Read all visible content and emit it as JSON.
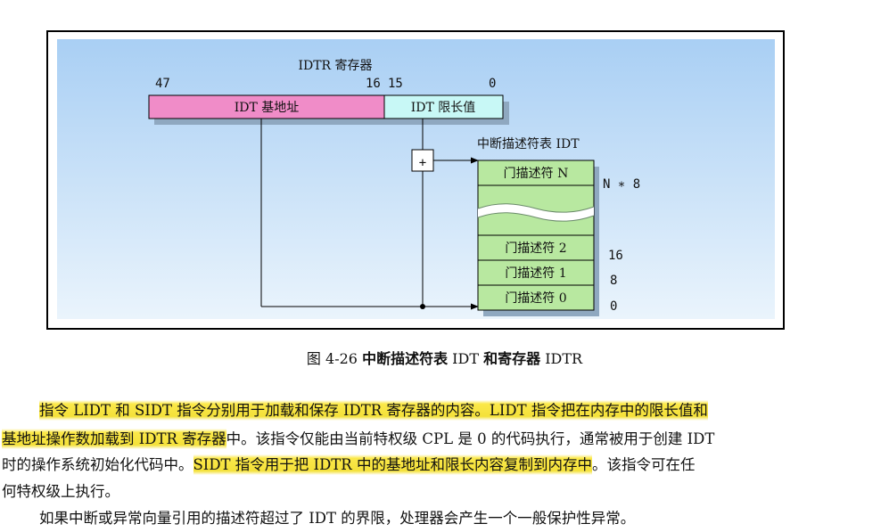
{
  "figure": {
    "register_title": "IDTR 寄存器",
    "bit_47": "47",
    "bit_16": "16",
    "bit_15": "15",
    "bit_0": "0",
    "base_label": "IDT 基地址",
    "limit_label": "IDT 限长值",
    "table_title": "中断描述符表 IDT",
    "gate_n": "门描述符 N",
    "gate_2": "门描述符 2",
    "gate_1": "门描述符 1",
    "gate_0": "门描述符 0",
    "offset_n8": "N ∗ 8",
    "offset_16": "16",
    "offset_8": "8",
    "offset_0": "0",
    "adder_symbol": "+",
    "colors": {
      "background_blue": "#b4d6f6",
      "base_field": "#f08cc8",
      "limit_field": "#c8f8f6",
      "gate_green": "#b8e8a0"
    }
  },
  "caption": {
    "prefix": "图 4-26",
    "bold_text": "中断描述符表",
    "mid1": "IDT",
    "bold_text2": "和寄存器",
    "suffix": "IDTR"
  },
  "paragraph": {
    "l1_a": "指令 LIDT 和 SIDT 指令分别用于加载和保存 IDTR 寄存器的内容。LIDT 指令把在内存中的限长值和",
    "l2_a": "基地址操作数加载到 IDTR 寄存器",
    "l2_b": "中。该指令仅能由当前特权级 CPL 是 0 的代码执行，通常被用于创建 IDT",
    "l3_a": "时的操作系统初始化代码中。",
    "l3_b": "SIDT 指令用于把 IDTR 中的基地址和限长内容复制到内存中",
    "l3_c": "。该指令可在任",
    "l4": "何特权级上执行。",
    "l5": "如果中断或异常向量引用的描述符超过了 IDT 的界限，处理器会产生一个一般保护性异常。"
  }
}
